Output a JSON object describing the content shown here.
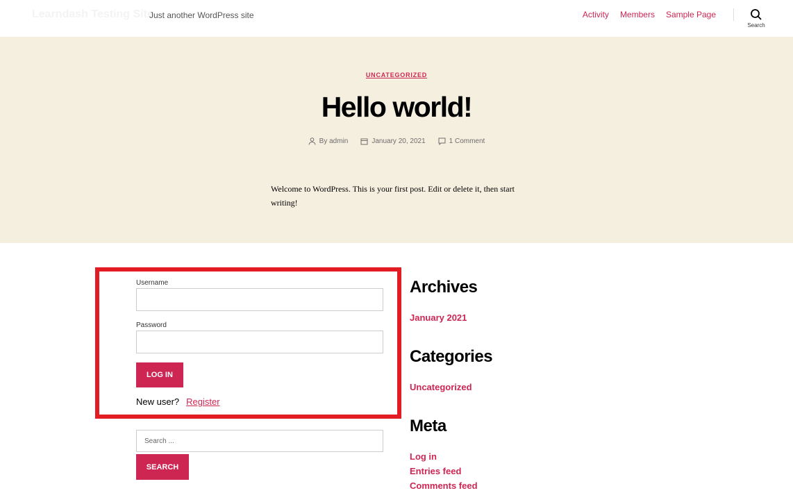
{
  "header": {
    "site_title": "Learndash Testing Site",
    "tagline": "Just another WordPress site",
    "nav": [
      "Activity",
      "Members",
      "Sample Page"
    ],
    "search_label": "Search"
  },
  "post": {
    "category": "UNCATEGORIZED",
    "title": "Hello world!",
    "author": "By admin",
    "date": "January 20, 2021",
    "comments": "1 Comment",
    "content": "Welcome to WordPress. This is your first post. Edit or delete it, then start writing!"
  },
  "login": {
    "username_label": "Username",
    "username_value": "",
    "password_label": "Password",
    "password_value": "",
    "login_button": "LOG IN",
    "new_user": "New user?",
    "register": "Register"
  },
  "search": {
    "placeholder": "Search ...",
    "button": "SEARCH"
  },
  "sidebar": {
    "archives_title": "Archives",
    "archives": [
      "January 2021"
    ],
    "categories_title": "Categories",
    "categories": [
      "Uncategorized"
    ],
    "meta_title": "Meta",
    "meta": [
      "Log in",
      "Entries feed",
      "Comments feed"
    ]
  },
  "colors": {
    "accent": "#cd2653",
    "hero_bg": "#f5efe0",
    "highlight_border": "#e31b23"
  }
}
